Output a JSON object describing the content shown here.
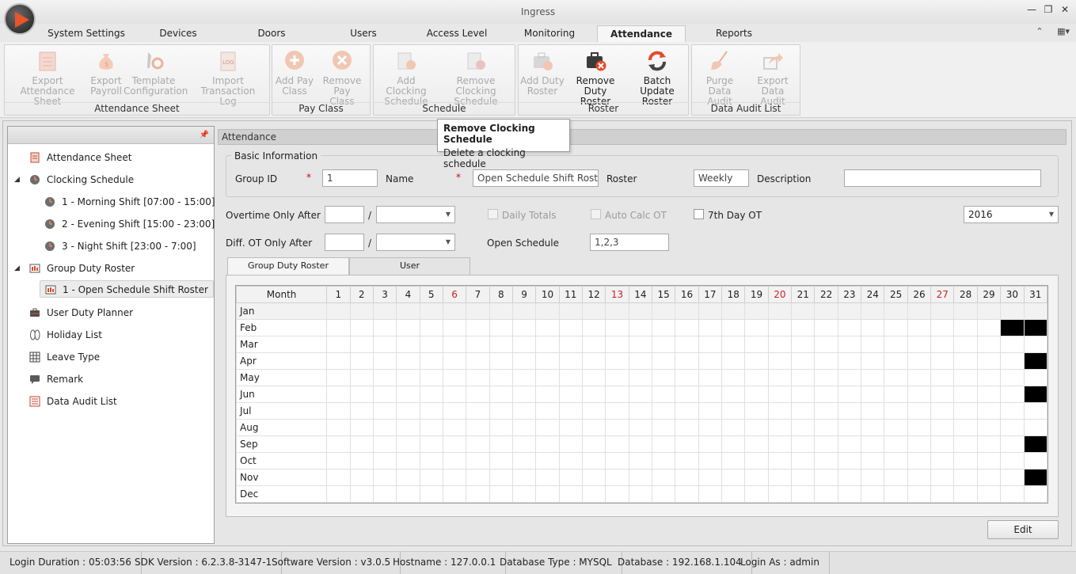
{
  "window": {
    "title": "Ingress"
  },
  "tabs": [
    "System Settings",
    "Devices",
    "Doors",
    "Users",
    "Access Level",
    "Monitoring",
    "Attendance",
    "Reports"
  ],
  "ribbon": {
    "attendance_sheet": {
      "label": "Attendance Sheet",
      "b1": [
        "Export Attendance",
        "Sheet"
      ],
      "b2": [
        "Export",
        "Payroll"
      ],
      "b3": [
        "Template",
        "Configuration"
      ],
      "b4": [
        "Import Transaction",
        "Log"
      ]
    },
    "pay_class": {
      "label": "Pay Class",
      "b1": [
        "Add Pay",
        "Class"
      ],
      "b2": [
        "Remove Pay",
        "Class"
      ]
    },
    "schedule": {
      "label": "Schedule",
      "b1": [
        "Add Clocking",
        "Schedule"
      ],
      "b2": [
        "Remove Clocking",
        "Schedule"
      ]
    },
    "roster": {
      "label": "Roster",
      "b1": [
        "Add Duty",
        "Roster"
      ],
      "b2": [
        "Remove Duty",
        "Roster"
      ],
      "b3": [
        "Batch Update",
        "Roster"
      ]
    },
    "audit": {
      "label": "Data Audit List",
      "b1": [
        "Purge Data",
        "Audit"
      ],
      "b2": [
        "Export Data",
        "Audit"
      ]
    }
  },
  "tooltip": {
    "title": "Remove Clocking Schedule",
    "text": "Delete a clocking schedule"
  },
  "tree": {
    "attendance_sheet": "Attendance Sheet",
    "clocking_schedule": "Clocking Schedule",
    "shift1": "1 - Morning Shift [07:00 - 15:00]",
    "shift2": "2 - Evening Shift [15:00 - 23:00]",
    "shift3": "3 - Night Shift [23:00 - 7:00]",
    "group_duty_roster": "Group Duty Roster",
    "roster1": "1 - Open Schedule Shift Roster",
    "user_duty_planner": "User Duty Planner",
    "holiday_list": "Holiday List",
    "leave_type": "Leave Type",
    "remark": "Remark",
    "data_audit_list": "Data Audit List"
  },
  "panel": {
    "header": "Attendance",
    "basic_info": "Basic Information",
    "group_id_label": "Group ID",
    "group_id_value": "1",
    "name_label": "Name",
    "name_value": "Open Schedule Shift Roster",
    "roster_label": "Roster",
    "roster_value": "Weekly",
    "description_label": "Description",
    "description_value": "",
    "required_mark": "*",
    "overtime_label": "Overtime Only After",
    "diff_ot_label": "Diff. OT Only After",
    "slash": "/",
    "daily_totals": "Daily Totals",
    "auto_calc_ot": "Auto Calc OT",
    "seventh_day_ot": "7th Day OT",
    "open_schedule_label": "Open Schedule",
    "open_schedule_value": "1,2,3",
    "year": "2016",
    "tab_group": "Group Duty Roster",
    "tab_user": "User",
    "edit_button": "Edit"
  },
  "grid": {
    "month_header": "Month",
    "days": [
      "1",
      "2",
      "3",
      "4",
      "5",
      "6",
      "7",
      "8",
      "9",
      "10",
      "11",
      "12",
      "13",
      "14",
      "15",
      "16",
      "17",
      "18",
      "19",
      "20",
      "21",
      "22",
      "23",
      "24",
      "25",
      "26",
      "27",
      "28",
      "29",
      "30",
      "31"
    ],
    "red_days": [
      6,
      13,
      20,
      27
    ],
    "months": [
      "Jan",
      "Feb",
      "Mar",
      "Apr",
      "May",
      "Jun",
      "Jul",
      "Aug",
      "Sep",
      "Oct",
      "Nov",
      "Dec"
    ],
    "unavailable": {
      "Feb": [
        30,
        31
      ],
      "Apr": [
        31
      ],
      "Jun": [
        31
      ],
      "Sep": [
        31
      ],
      "Nov": [
        31
      ]
    }
  },
  "status": {
    "login_duration": "Login Duration : 05:03:56",
    "sdk_version": "SDK Version : 6.2.3.8-3147-1",
    "software_version": "Software Version : v3.0.5",
    "hostname": "Hostname : 127.0.0.1",
    "database_type": "Database Type : MYSQL",
    "database": "Database : 192.168.1.104",
    "login_as": "Login As : admin"
  }
}
